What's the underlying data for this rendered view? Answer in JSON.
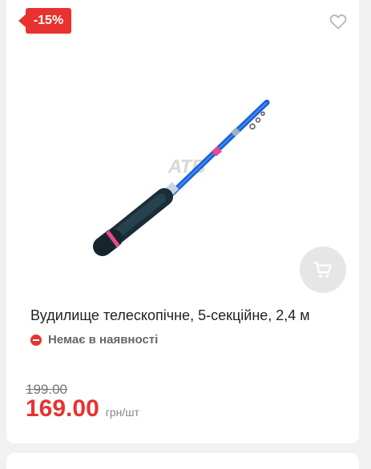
{
  "product": {
    "discount_badge": "-15%",
    "title": "Вудилище телескопічне, 5-секційне, 2,4 м",
    "stock_status": "Немає в наявності",
    "old_price": "199.00",
    "price": "169.00",
    "unit": "грн/шт",
    "image_watermark": "АТБ"
  },
  "icons": {
    "favorite": "heart-outline-icon",
    "cart": "shopping-cart-icon",
    "stock": "minus-circle-icon"
  },
  "colors": {
    "accent": "#e8322f",
    "background": "#f1f1f1",
    "card": "#ffffff",
    "cart_button": "#e6e6e6"
  }
}
